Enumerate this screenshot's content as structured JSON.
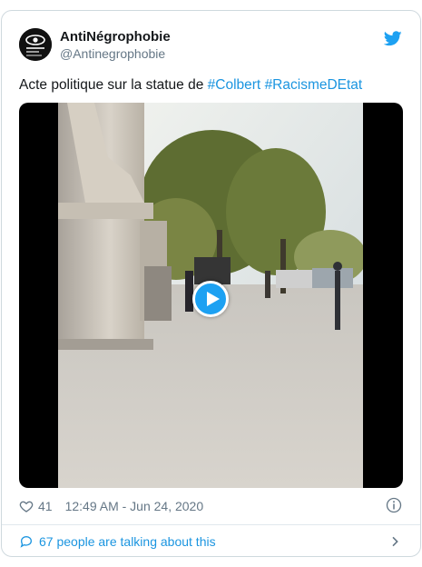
{
  "tweet": {
    "display_name": "AntiNégrophobie",
    "handle": "@Antinegrophobie",
    "text_prefix": "Acte politique sur la statue de ",
    "hashtags": [
      "#Colbert",
      "#RacismeDEtat"
    ],
    "like_count": "41",
    "timestamp": "12:49 AM - Jun 24, 2020",
    "talking_text": "67 people are talking about this"
  },
  "icons": {
    "brand": "twitter-bird-icon",
    "play": "play-icon",
    "like": "heart-icon",
    "info": "info-icon",
    "comment": "comment-bubble-icon",
    "chevron": "chevron-right-icon"
  },
  "colors": {
    "accent": "#1da1f2",
    "link": "#1b95e0",
    "muted": "#657786",
    "border": "#cfd9de"
  }
}
